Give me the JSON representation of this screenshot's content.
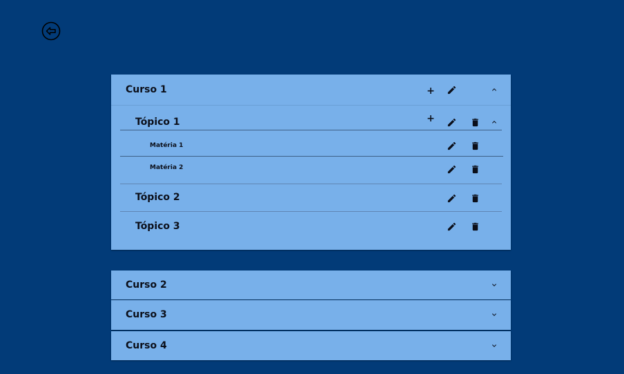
{
  "back": {
    "icon": "arrow-left-circle-icon"
  },
  "courses": [
    {
      "label": "Curso 1",
      "expanded": true,
      "topics": [
        {
          "label": "Tópico 1",
          "expanded": true,
          "subjects": [
            {
              "label": "Matéria 1"
            },
            {
              "label": "Matéria 2"
            }
          ]
        },
        {
          "label": "Tópico 2",
          "expanded": false
        },
        {
          "label": "Tópico 3",
          "expanded": false
        }
      ]
    },
    {
      "label": "Curso 2",
      "expanded": false
    },
    {
      "label": "Curso 3",
      "expanded": false
    },
    {
      "label": "Curso 4",
      "expanded": false
    }
  ],
  "icons": {
    "add": "plus-icon",
    "edit": "pencil-icon",
    "delete": "trash-icon",
    "expand": "chevron-down-icon",
    "collapse": "chevron-up-icon"
  },
  "glyphs": {
    "add": "+"
  },
  "colors": {
    "background": "#023b78",
    "panel": "#78b0ea",
    "text": "#0b0f1a"
  }
}
